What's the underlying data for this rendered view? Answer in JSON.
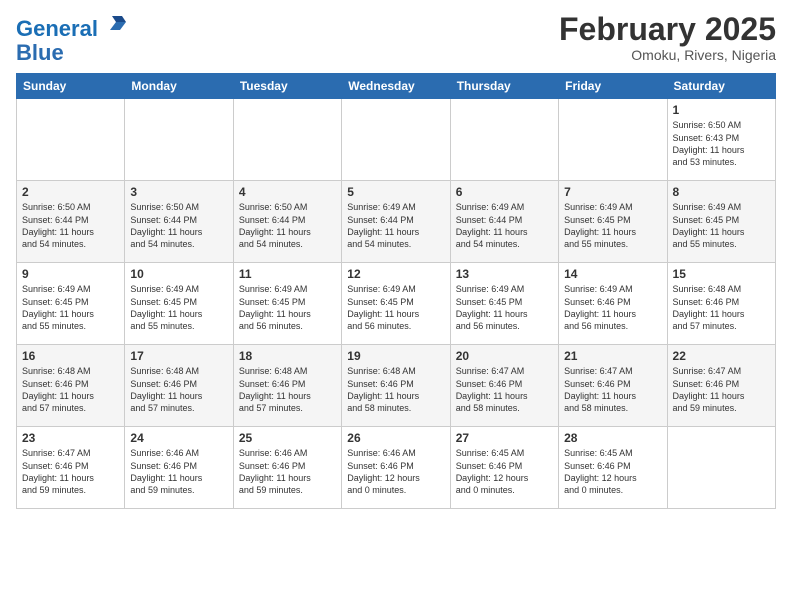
{
  "header": {
    "logo_line1": "General",
    "logo_line2": "Blue",
    "title": "February 2025",
    "subtitle": "Omoku, Rivers, Nigeria"
  },
  "days_of_week": [
    "Sunday",
    "Monday",
    "Tuesday",
    "Wednesday",
    "Thursday",
    "Friday",
    "Saturday"
  ],
  "weeks": [
    [
      {
        "day": "",
        "info": ""
      },
      {
        "day": "",
        "info": ""
      },
      {
        "day": "",
        "info": ""
      },
      {
        "day": "",
        "info": ""
      },
      {
        "day": "",
        "info": ""
      },
      {
        "day": "",
        "info": ""
      },
      {
        "day": "1",
        "info": "Sunrise: 6:50 AM\nSunset: 6:43 PM\nDaylight: 11 hours\nand 53 minutes."
      }
    ],
    [
      {
        "day": "2",
        "info": "Sunrise: 6:50 AM\nSunset: 6:44 PM\nDaylight: 11 hours\nand 54 minutes."
      },
      {
        "day": "3",
        "info": "Sunrise: 6:50 AM\nSunset: 6:44 PM\nDaylight: 11 hours\nand 54 minutes."
      },
      {
        "day": "4",
        "info": "Sunrise: 6:50 AM\nSunset: 6:44 PM\nDaylight: 11 hours\nand 54 minutes."
      },
      {
        "day": "5",
        "info": "Sunrise: 6:49 AM\nSunset: 6:44 PM\nDaylight: 11 hours\nand 54 minutes."
      },
      {
        "day": "6",
        "info": "Sunrise: 6:49 AM\nSunset: 6:44 PM\nDaylight: 11 hours\nand 54 minutes."
      },
      {
        "day": "7",
        "info": "Sunrise: 6:49 AM\nSunset: 6:45 PM\nDaylight: 11 hours\nand 55 minutes."
      },
      {
        "day": "8",
        "info": "Sunrise: 6:49 AM\nSunset: 6:45 PM\nDaylight: 11 hours\nand 55 minutes."
      }
    ],
    [
      {
        "day": "9",
        "info": "Sunrise: 6:49 AM\nSunset: 6:45 PM\nDaylight: 11 hours\nand 55 minutes."
      },
      {
        "day": "10",
        "info": "Sunrise: 6:49 AM\nSunset: 6:45 PM\nDaylight: 11 hours\nand 55 minutes."
      },
      {
        "day": "11",
        "info": "Sunrise: 6:49 AM\nSunset: 6:45 PM\nDaylight: 11 hours\nand 56 minutes."
      },
      {
        "day": "12",
        "info": "Sunrise: 6:49 AM\nSunset: 6:45 PM\nDaylight: 11 hours\nand 56 minutes."
      },
      {
        "day": "13",
        "info": "Sunrise: 6:49 AM\nSunset: 6:45 PM\nDaylight: 11 hours\nand 56 minutes."
      },
      {
        "day": "14",
        "info": "Sunrise: 6:49 AM\nSunset: 6:46 PM\nDaylight: 11 hours\nand 56 minutes."
      },
      {
        "day": "15",
        "info": "Sunrise: 6:48 AM\nSunset: 6:46 PM\nDaylight: 11 hours\nand 57 minutes."
      }
    ],
    [
      {
        "day": "16",
        "info": "Sunrise: 6:48 AM\nSunset: 6:46 PM\nDaylight: 11 hours\nand 57 minutes."
      },
      {
        "day": "17",
        "info": "Sunrise: 6:48 AM\nSunset: 6:46 PM\nDaylight: 11 hours\nand 57 minutes."
      },
      {
        "day": "18",
        "info": "Sunrise: 6:48 AM\nSunset: 6:46 PM\nDaylight: 11 hours\nand 57 minutes."
      },
      {
        "day": "19",
        "info": "Sunrise: 6:48 AM\nSunset: 6:46 PM\nDaylight: 11 hours\nand 58 minutes."
      },
      {
        "day": "20",
        "info": "Sunrise: 6:47 AM\nSunset: 6:46 PM\nDaylight: 11 hours\nand 58 minutes."
      },
      {
        "day": "21",
        "info": "Sunrise: 6:47 AM\nSunset: 6:46 PM\nDaylight: 11 hours\nand 58 minutes."
      },
      {
        "day": "22",
        "info": "Sunrise: 6:47 AM\nSunset: 6:46 PM\nDaylight: 11 hours\nand 59 minutes."
      }
    ],
    [
      {
        "day": "23",
        "info": "Sunrise: 6:47 AM\nSunset: 6:46 PM\nDaylight: 11 hours\nand 59 minutes."
      },
      {
        "day": "24",
        "info": "Sunrise: 6:46 AM\nSunset: 6:46 PM\nDaylight: 11 hours\nand 59 minutes."
      },
      {
        "day": "25",
        "info": "Sunrise: 6:46 AM\nSunset: 6:46 PM\nDaylight: 11 hours\nand 59 minutes."
      },
      {
        "day": "26",
        "info": "Sunrise: 6:46 AM\nSunset: 6:46 PM\nDaylight: 12 hours\nand 0 minutes."
      },
      {
        "day": "27",
        "info": "Sunrise: 6:45 AM\nSunset: 6:46 PM\nDaylight: 12 hours\nand 0 minutes."
      },
      {
        "day": "28",
        "info": "Sunrise: 6:45 AM\nSunset: 6:46 PM\nDaylight: 12 hours\nand 0 minutes."
      },
      {
        "day": "",
        "info": ""
      }
    ]
  ]
}
